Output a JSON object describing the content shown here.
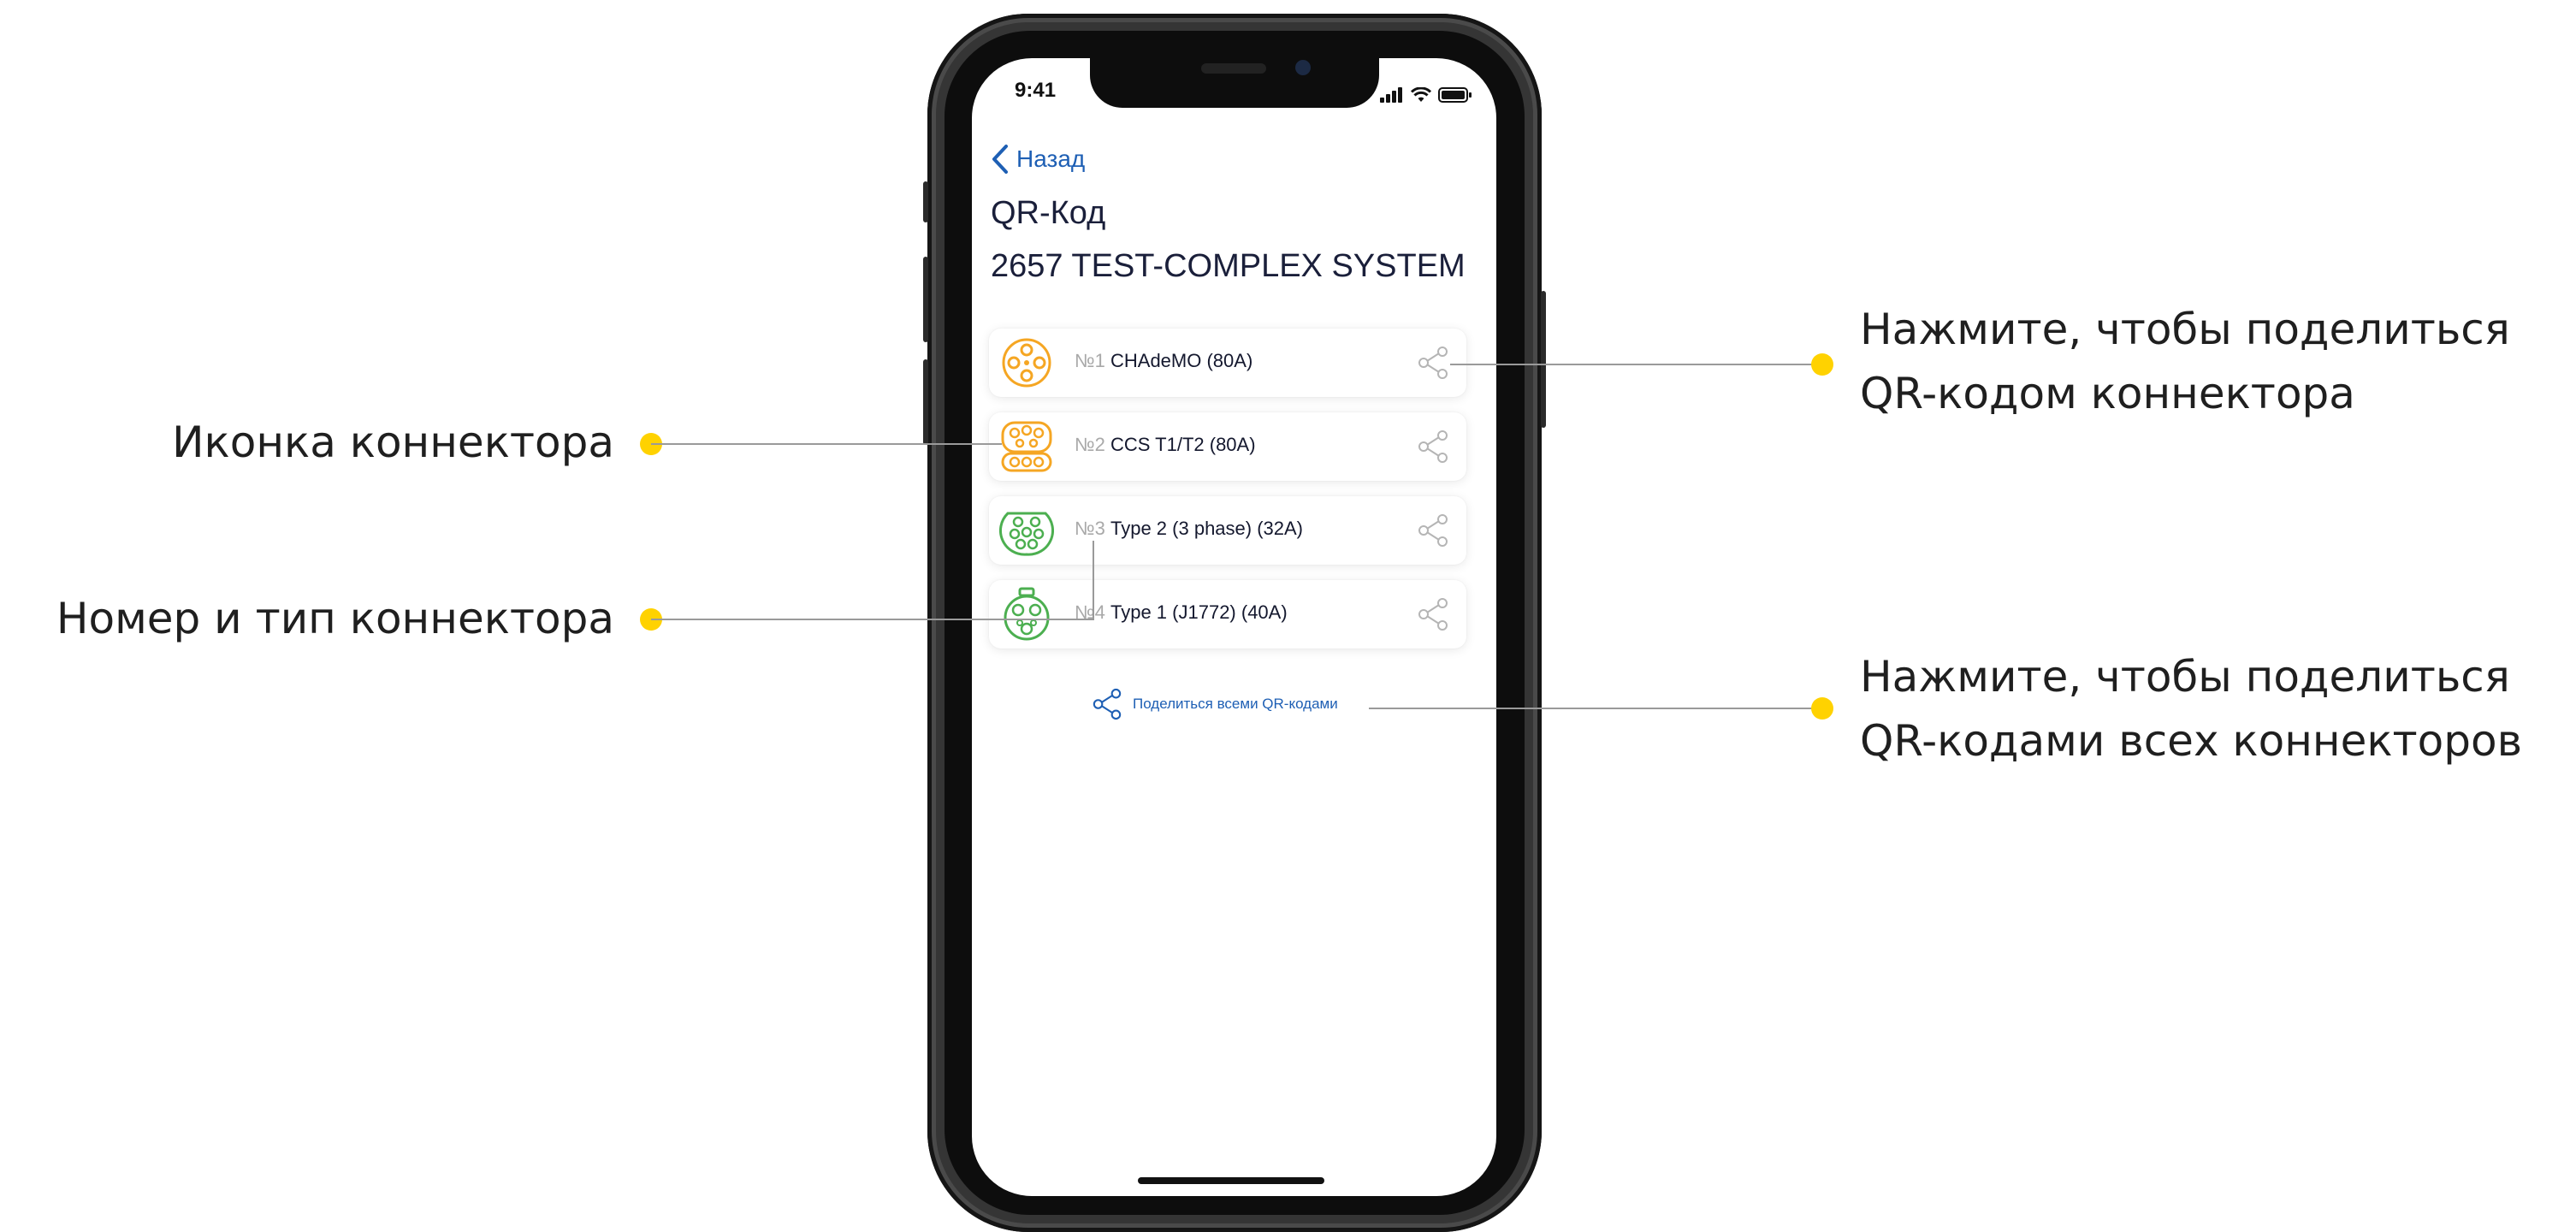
{
  "status_bar": {
    "time": "9:41"
  },
  "nav": {
    "back_label": "Назад"
  },
  "screen": {
    "title": "QR-Код",
    "subtitle": "2657 TEST-COMPLEX SYSTEM"
  },
  "connectors": [
    {
      "number": "№1",
      "name": "CHAdeMO (80A)",
      "icon": "chademo-connector-icon",
      "color": "#f5a623"
    },
    {
      "number": "№2",
      "name": "CCS T1/T2 (80A)",
      "icon": "ccs-connector-icon",
      "color": "#f5a623"
    },
    {
      "number": "№3",
      "name": "Type 2 (3 phase) (32A)",
      "icon": "type2-connector-icon",
      "color": "#4caf50"
    },
    {
      "number": "№4",
      "name": "Type 1 (J1772) (40A)",
      "icon": "type1-connector-icon",
      "color": "#4caf50"
    }
  ],
  "share_all_label": "Поделиться всеми QR-кодами",
  "callouts": {
    "connector_icon": "Иконка коннектора",
    "number_type": "Номер и тип коннектора",
    "share_one": [
      "Нажмите, чтобы поделиться",
      "QR-кодом коннектора"
    ],
    "share_all": [
      "Нажмите, чтобы поделиться",
      "QR-кодами всех коннекторов"
    ]
  },
  "colors": {
    "accent": "#1e5fb4",
    "callout_dot": "#ffd200",
    "connector_orange": "#f5a623",
    "connector_green": "#4caf50"
  }
}
